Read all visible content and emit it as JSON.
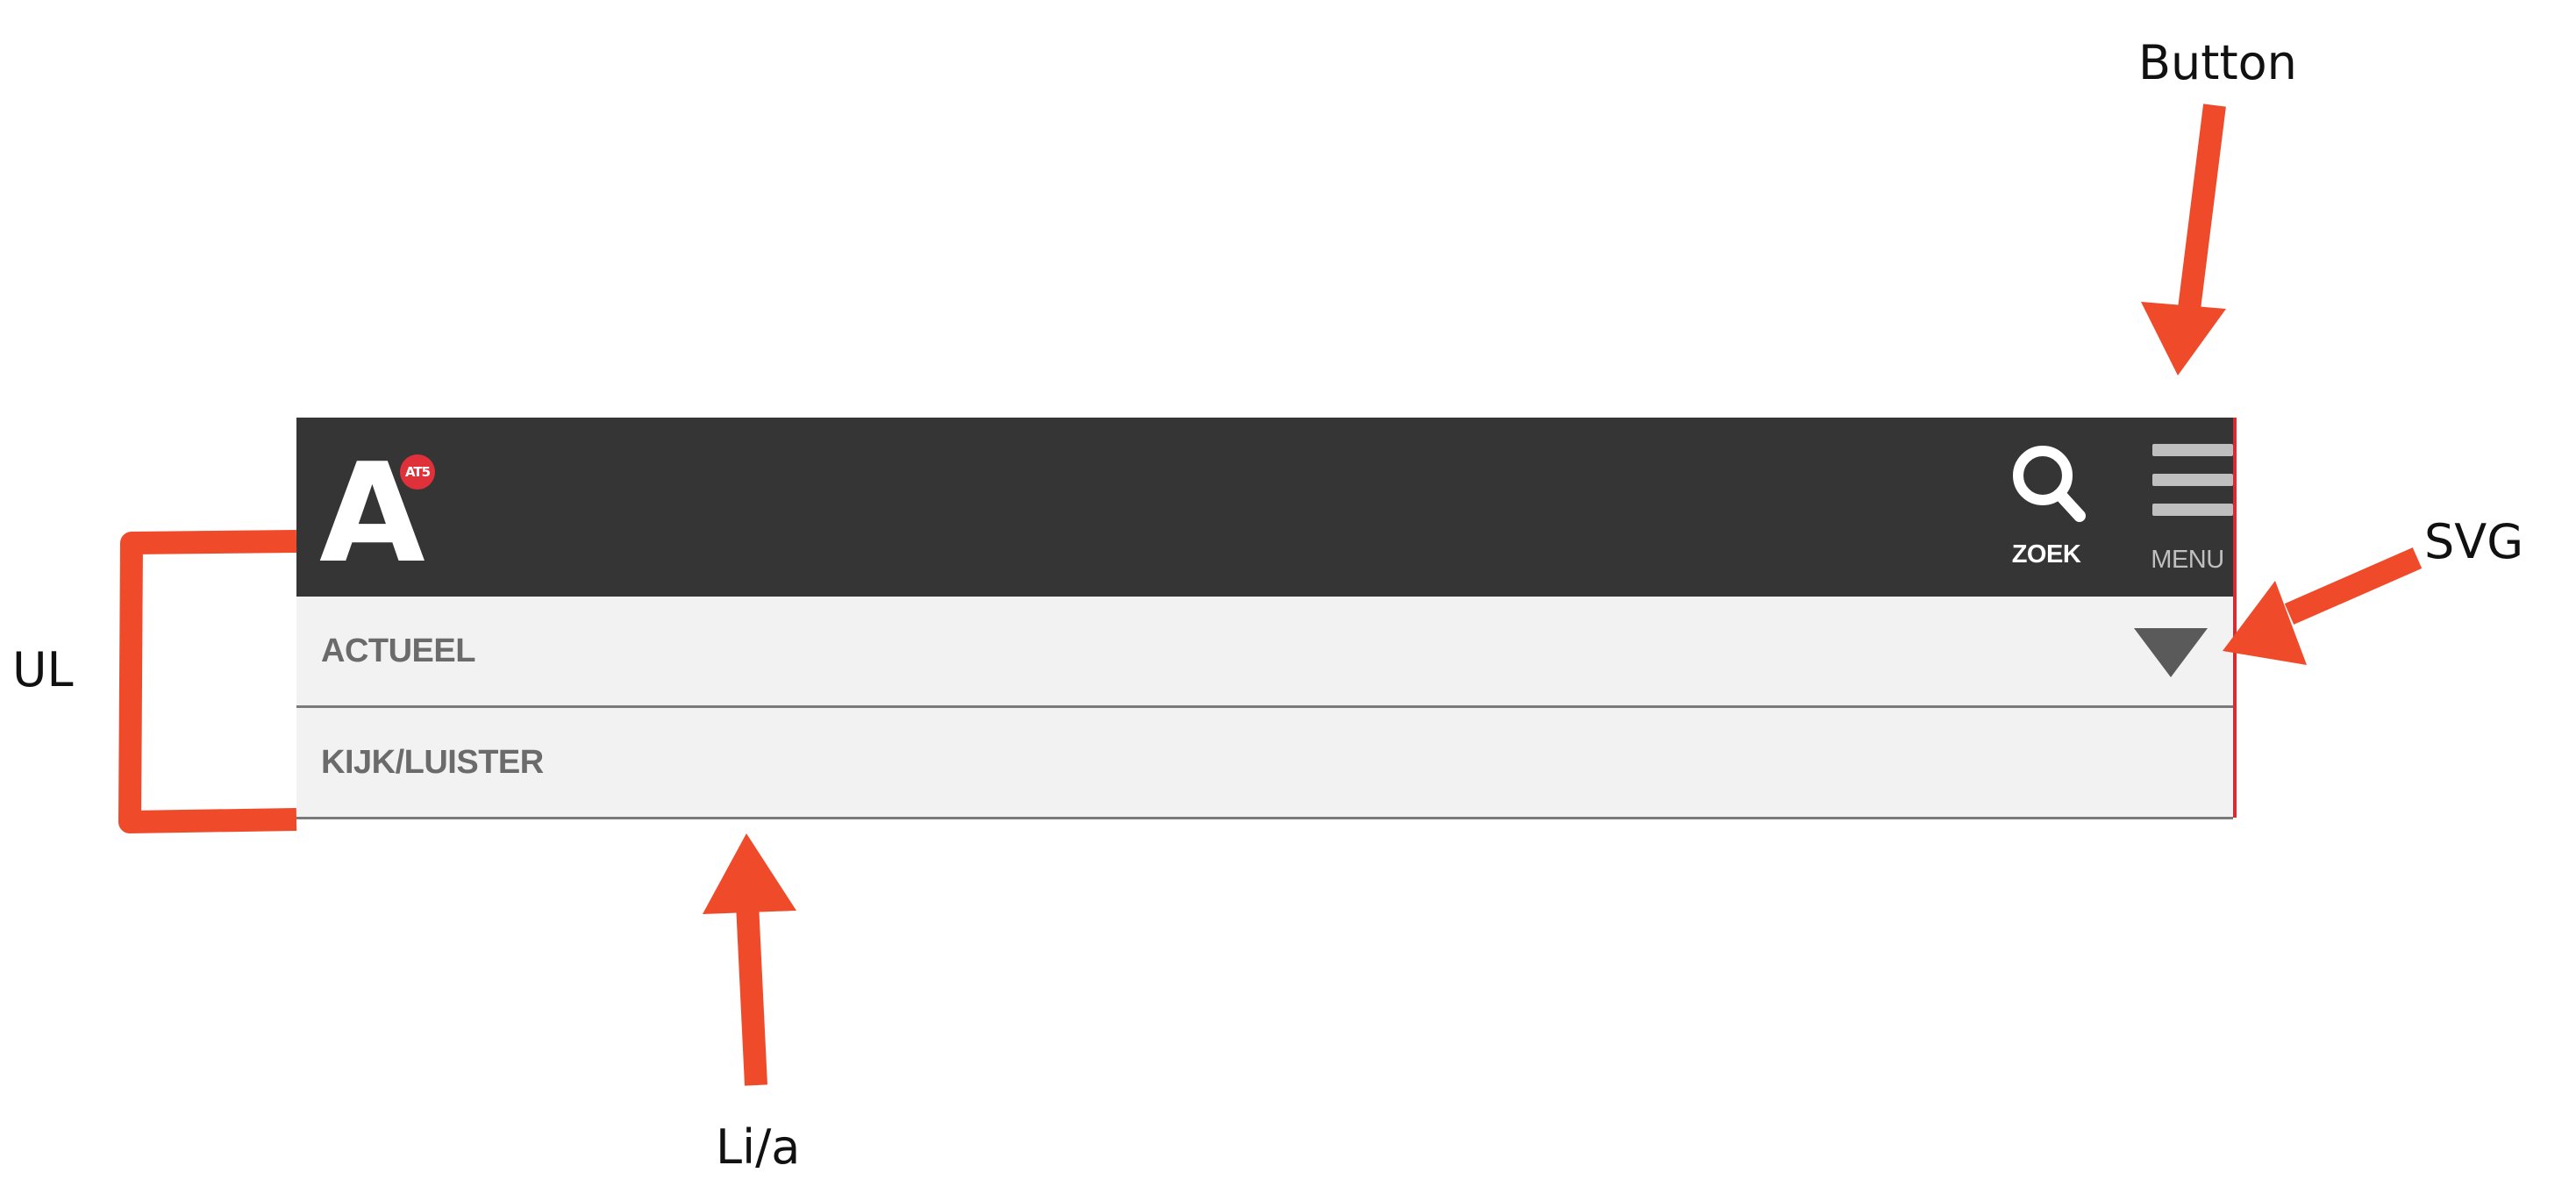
{
  "header": {
    "logo_letter": "A",
    "logo_badge": "AT5",
    "search_label": "ZOEK",
    "menu_label": "MENU"
  },
  "nav": {
    "items": [
      {
        "label": "ACTUEEL",
        "has_submenu": true
      },
      {
        "label": "KIJK/LUISTER",
        "has_submenu": false
      }
    ]
  },
  "annotations": {
    "button": "Button",
    "svg": "SVG",
    "ul": "UL",
    "li_a": "Li/a"
  },
  "colors": {
    "topbar": "#353535",
    "list_bg": "#f2f2f2",
    "accent_red": "#d92b32",
    "annotation": "#ef4a2a",
    "nav_text": "#6b6b6b"
  },
  "icons": {
    "search": "magnifier-icon",
    "menu": "hamburger-icon",
    "submenu": "triangle-down-icon"
  }
}
